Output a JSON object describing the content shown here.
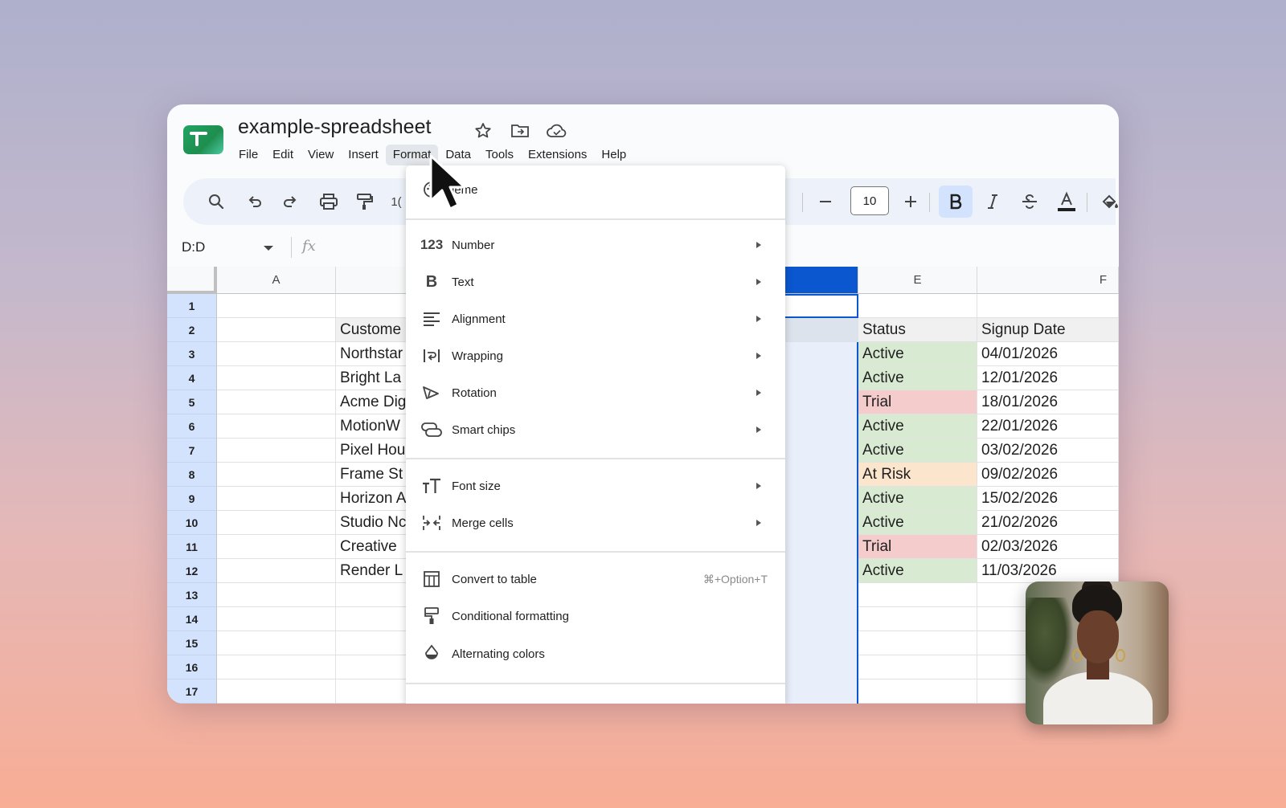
{
  "app": {
    "title": "example-spreadsheet",
    "menu": [
      "File",
      "Edit",
      "View",
      "Insert",
      "Format",
      "Data",
      "Tools",
      "Extensions",
      "Help"
    ]
  },
  "toolbar": {
    "font_size": "10",
    "font_size_partial": "1("
  },
  "formula_bar": {
    "name_box": "D:D",
    "fx_label": "fx"
  },
  "grid": {
    "columns": {
      "A": "A",
      "E": "E",
      "F": "F"
    },
    "row_numbers": [
      "1",
      "2",
      "3",
      "4",
      "5",
      "6",
      "7",
      "8",
      "9",
      "10",
      "11",
      "12",
      "13",
      "14",
      "15",
      "16",
      "17"
    ],
    "headers": {
      "customer": "Custome",
      "status": "Status",
      "signup": "Signup Date"
    },
    "rows": [
      {
        "customer": "Northstar",
        "status": "Active",
        "signup": "04/01/2026"
      },
      {
        "customer": "Bright La",
        "status": "Active",
        "signup": "12/01/2026"
      },
      {
        "customer": "Acme Dig",
        "status": "Trial",
        "signup": "18/01/2026"
      },
      {
        "customer": "MotionW",
        "status": "Active",
        "signup": "22/01/2026"
      },
      {
        "customer": "Pixel Hou",
        "status": "Active",
        "signup": "03/02/2026"
      },
      {
        "customer": "Frame St",
        "status": "At Risk",
        "signup": "09/02/2026"
      },
      {
        "customer": "Horizon A",
        "status": "Active",
        "signup": "15/02/2026"
      },
      {
        "customer": "Studio Nc",
        "status": "Active",
        "signup": "21/02/2026"
      },
      {
        "customer": "Creative",
        "status": "Trial",
        "signup": "02/03/2026"
      },
      {
        "customer": "Render L",
        "status": "Active",
        "signup": "11/03/2026"
      }
    ]
  },
  "format_menu": {
    "theme_partial": "ieme",
    "items": {
      "number": "Number",
      "text": "Text",
      "alignment": "Alignment",
      "wrapping": "Wrapping",
      "rotation": "Rotation",
      "smart_chips": "Smart chips",
      "font_size": "Font size",
      "merge_cells": "Merge cells",
      "convert_to_table": "Convert to table",
      "convert_shortcut": "⌘+Option+T",
      "conditional_formatting": "Conditional formatting",
      "alternating_colors": "Alternating colors"
    }
  },
  "colors": {
    "accent": "#0b57d0",
    "status_active": "#d9ead3",
    "status_trial": "#f4cccc",
    "status_risk": "#fce5cd"
  }
}
